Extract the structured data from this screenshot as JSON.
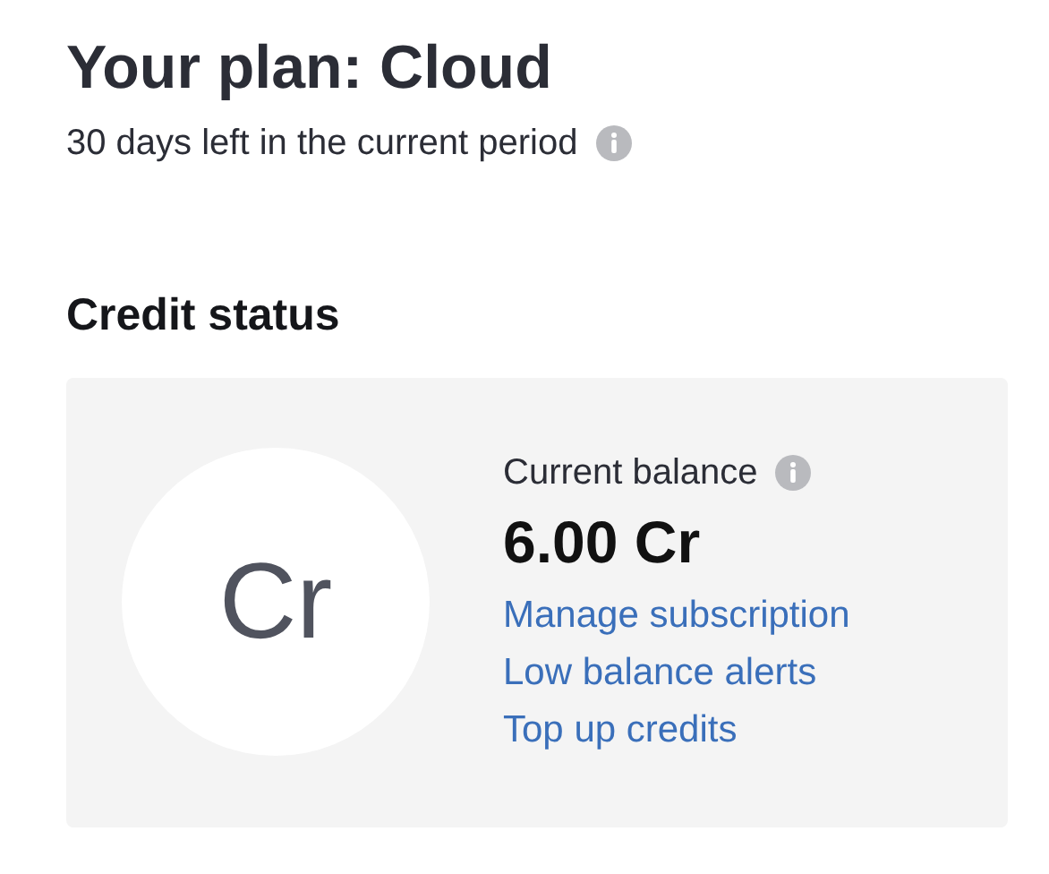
{
  "plan": {
    "title": "Your plan: Cloud",
    "period": "30 days left in the current period"
  },
  "credit_status": {
    "heading": "Credit status",
    "avatar": "Cr",
    "balance_label": "Current balance",
    "balance": "6.00 Cr",
    "links": [
      "Manage subscription",
      "Low balance alerts",
      "Top up credits"
    ]
  }
}
